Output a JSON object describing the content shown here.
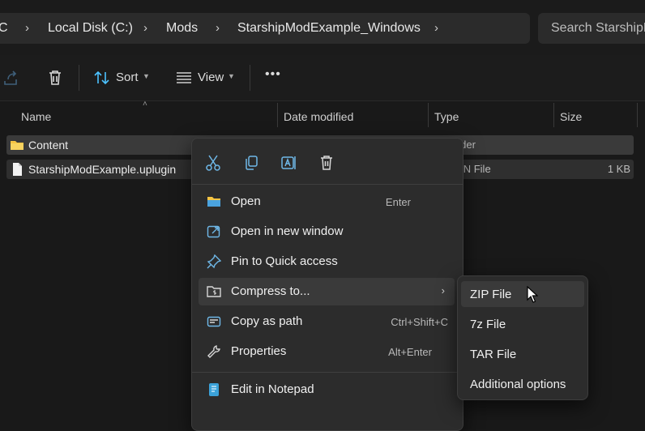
{
  "breadcrumb": {
    "items": [
      "C",
      "Local Disk (C:)",
      "Mods",
      "StarshipModExample_Windows"
    ]
  },
  "search": {
    "placeholder": "Search StarshipM"
  },
  "toolbar": {
    "sort_label": "Sort",
    "view_label": "View",
    "more_label": "•••"
  },
  "columns": {
    "name": "Name",
    "date_modified": "Date modified",
    "type": "Type",
    "size": "Size"
  },
  "files": [
    {
      "name": "Content",
      "type": "older",
      "size": ""
    },
    {
      "name": "StarshipModExample.uplugin",
      "type": "GIN File",
      "size": "1 KB"
    }
  ],
  "context_menu": {
    "items": [
      {
        "label": "Open",
        "shortcut": "Enter",
        "icon": "folder-icon"
      },
      {
        "label": "Open in new window",
        "shortcut": "",
        "icon": "open-new-window-icon"
      },
      {
        "label": "Pin to Quick access",
        "shortcut": "",
        "icon": "pin-icon"
      },
      {
        "label": "Compress to...",
        "shortcut": "",
        "icon": "compress-icon",
        "submenu": true
      },
      {
        "label": "Copy as path",
        "shortcut": "Ctrl+Shift+C",
        "icon": "copy-path-icon"
      },
      {
        "label": "Properties",
        "shortcut": "Alt+Enter",
        "icon": "properties-icon"
      },
      {
        "label": "Edit in Notepad",
        "shortcut": "",
        "icon": "notepad-icon"
      }
    ]
  },
  "submenu": {
    "items": [
      "ZIP File",
      "7z File",
      "TAR File",
      "Additional options"
    ]
  },
  "colors": {
    "accent": "#4cc2ff",
    "folder": "#f5c443",
    "background": "#191919",
    "menu": "#2c2c2c"
  }
}
